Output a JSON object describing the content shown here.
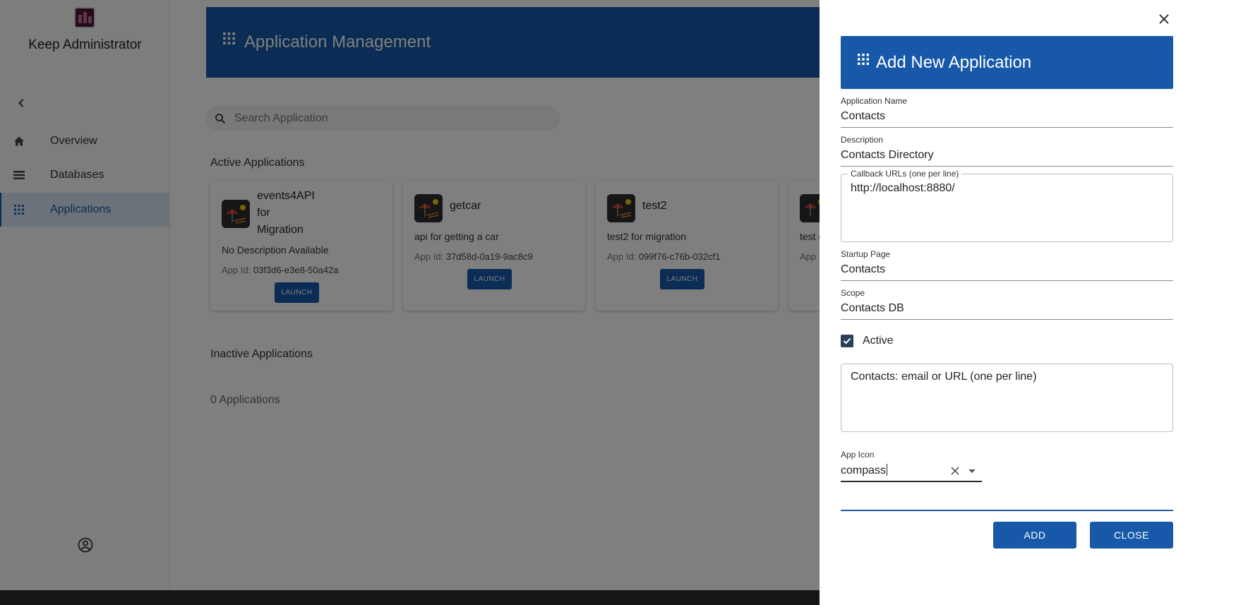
{
  "sidebar": {
    "app_title": "Keep Administrator",
    "nav": [
      {
        "label": "Overview",
        "icon": "home-icon"
      },
      {
        "label": "Databases",
        "icon": "list-icon"
      },
      {
        "label": "Applications",
        "icon": "apps-grid-icon",
        "active": true
      }
    ]
  },
  "header": {
    "title": "Application Management"
  },
  "search": {
    "placeholder": "Search Application"
  },
  "active_section": {
    "title": "Active Applications"
  },
  "cards": [
    {
      "name_lines": [
        "events4API",
        "for",
        "Migration"
      ],
      "description": "No Description Available",
      "app_id_label": "App Id:",
      "app_id": "03f3d6-e3e8-50a42a",
      "launch": "LAUNCH"
    },
    {
      "name_lines": [
        "getcar"
      ],
      "description": "api for getting a car",
      "app_id_label": "App Id:",
      "app_id": "37d58d-0a19-9ac8c9",
      "launch": "LAUNCH"
    },
    {
      "name_lines": [
        "test2"
      ],
      "description": "test2 for migration",
      "app_id_label": "App Id:",
      "app_id": "099f76-c76b-032cf1",
      "launch": "LAUNCH"
    },
    {
      "description_partial": "test c",
      "app_id_label_partial": "App"
    }
  ],
  "inactive_section": {
    "title": "Inactive Applications",
    "count": "0 Applications"
  },
  "drawer": {
    "title": "Add New Application",
    "fields": {
      "app_name": {
        "label": "Application Name",
        "value": "Contacts"
      },
      "description": {
        "label": "Description",
        "value": "Contacts Directory"
      },
      "callback_urls": {
        "label": "Callback URLs (one per line)",
        "value": "http://localhost:8880/"
      },
      "startup_page": {
        "label": "Startup Page",
        "value": "Contacts"
      },
      "scope": {
        "label": "Scope",
        "value": "Contacts DB"
      },
      "active": {
        "label": "Active",
        "checked": true
      },
      "access_list": {
        "value": "Contacts: email or URL (one per line)"
      },
      "app_icon": {
        "label": "App Icon",
        "value": "compass"
      }
    },
    "buttons": {
      "add": "ADD",
      "close": "CLOSE"
    }
  },
  "colors": {
    "primary": "#1759a8",
    "overlay": "rgba(0,0,0,0.5)",
    "active_nav_bg": "#d7e5f3"
  }
}
